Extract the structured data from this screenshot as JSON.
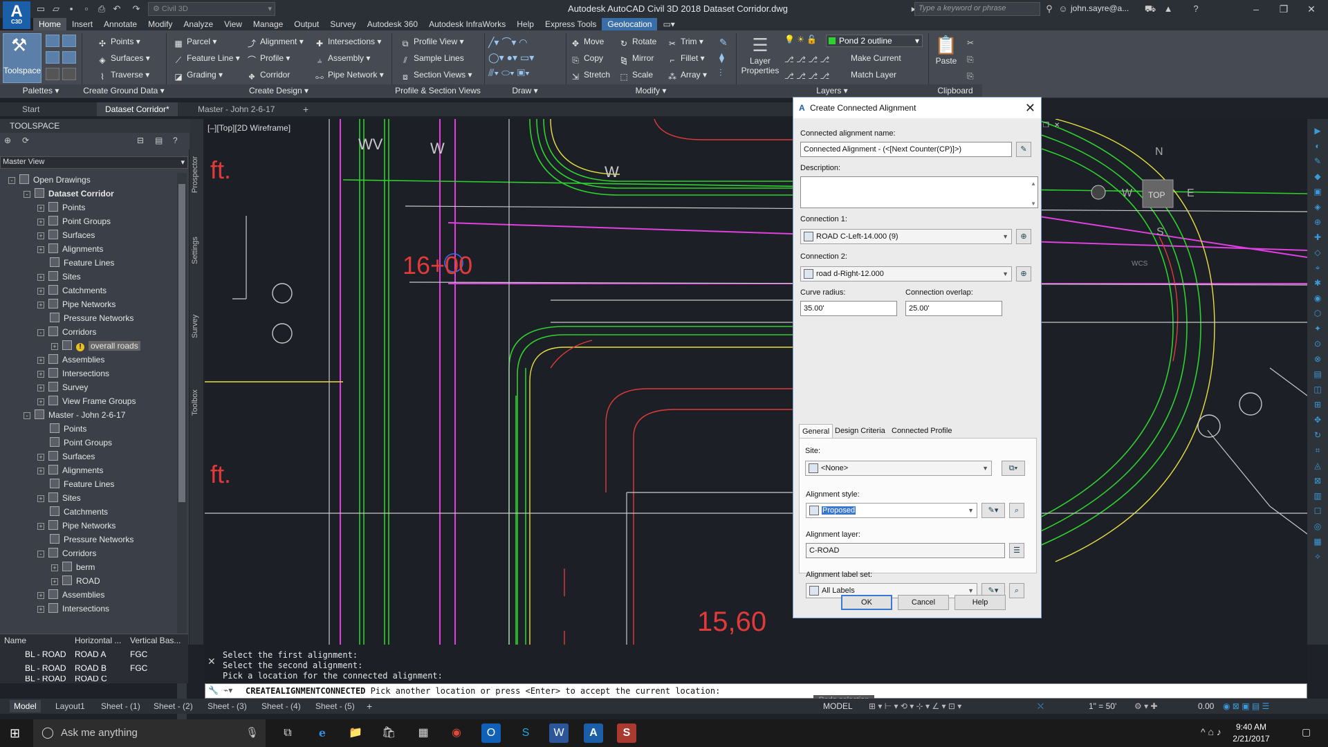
{
  "app": {
    "title": "Autodesk AutoCAD Civil 3D 2018   Dataset Corridor.dwg",
    "logo": "A",
    "logo_sub": "C3D",
    "workspace": "Civil 3D",
    "search_placeholder": "Type a keyword or phrase",
    "user": "john.sayre@a..."
  },
  "ribbon_tabs": [
    "Home",
    "Insert",
    "Annotate",
    "Modify",
    "Analyze",
    "View",
    "Manage",
    "Output",
    "Survey",
    "Autodesk 360",
    "Autodesk InfraWorks",
    "Help",
    "Express Tools",
    "Geolocation"
  ],
  "ribbon": {
    "toolspace": "Toolspace",
    "ground": [
      "Points",
      "Surfaces",
      "Traverse"
    ],
    "design_col1": [
      "Parcel",
      "Feature Line",
      "Grading"
    ],
    "design_col2": [
      "Alignment",
      "Profile",
      "Corridor"
    ],
    "design_col3": [
      "Intersections",
      "Assembly",
      "Pipe Network"
    ],
    "profile_col": [
      "Profile View",
      "Sample Lines",
      "Section Views"
    ],
    "modify_col1": [
      "Move",
      "Copy",
      "Stretch"
    ],
    "modify_col2": [
      "Rotate",
      "Mirror",
      "Scale"
    ],
    "modify_col3": [
      "Trim",
      "Fillet",
      "Array"
    ],
    "layer_props": "Layer Properties",
    "layer_current": "Pond 2 outline",
    "layer_make_current": "Make Current",
    "layer_match": "Match Layer",
    "paste": "Paste",
    "panels": [
      "Palettes",
      "Create Ground Data",
      "Create Design",
      "Profile & Section Views",
      "Draw",
      "Modify",
      "Layers",
      "Clipboard"
    ]
  },
  "doc_tabs": [
    "Start",
    "Dataset Corridor*",
    "Master - John 2-6-17"
  ],
  "toolspace": {
    "header": "TOOLSPACE",
    "view": "Master View",
    "side_tabs": [
      "Prospector",
      "Settings",
      "Survey",
      "Toolbox"
    ],
    "tree": [
      {
        "label": "Open Drawings",
        "lvl": 0,
        "exp": "-"
      },
      {
        "label": "Dataset Corridor",
        "lvl": 1,
        "exp": "-",
        "bold": true
      },
      {
        "label": "Points",
        "lvl": 2,
        "exp": "+"
      },
      {
        "label": "Point Groups",
        "lvl": 2,
        "exp": "+"
      },
      {
        "label": "Surfaces",
        "lvl": 2,
        "exp": "+"
      },
      {
        "label": "Alignments",
        "lvl": 2,
        "exp": "+"
      },
      {
        "label": "Feature Lines",
        "lvl": 2,
        "exp": ""
      },
      {
        "label": "Sites",
        "lvl": 2,
        "exp": "+"
      },
      {
        "label": "Catchments",
        "lvl": 2,
        "exp": "+"
      },
      {
        "label": "Pipe Networks",
        "lvl": 2,
        "exp": "+"
      },
      {
        "label": "Pressure Networks",
        "lvl": 2,
        "exp": ""
      },
      {
        "label": "Corridors",
        "lvl": 2,
        "exp": "-"
      },
      {
        "label": "overall roads",
        "lvl": 3,
        "exp": "+",
        "sel": true,
        "warn": true
      },
      {
        "label": "Assemblies",
        "lvl": 2,
        "exp": "+"
      },
      {
        "label": "Intersections",
        "lvl": 2,
        "exp": "+"
      },
      {
        "label": "Survey",
        "lvl": 2,
        "exp": "+"
      },
      {
        "label": "View Frame Groups",
        "lvl": 2,
        "exp": "+"
      },
      {
        "label": "Master - John 2-6-17",
        "lvl": 1,
        "exp": "-"
      },
      {
        "label": "Points",
        "lvl": 2,
        "exp": ""
      },
      {
        "label": "Point Groups",
        "lvl": 2,
        "exp": ""
      },
      {
        "label": "Surfaces",
        "lvl": 2,
        "exp": "+"
      },
      {
        "label": "Alignments",
        "lvl": 2,
        "exp": "+"
      },
      {
        "label": "Feature Lines",
        "lvl": 2,
        "exp": ""
      },
      {
        "label": "Sites",
        "lvl": 2,
        "exp": "+"
      },
      {
        "label": "Catchments",
        "lvl": 2,
        "exp": ""
      },
      {
        "label": "Pipe Networks",
        "lvl": 2,
        "exp": "+"
      },
      {
        "label": "Pressure Networks",
        "lvl": 2,
        "exp": ""
      },
      {
        "label": "Corridors",
        "lvl": 2,
        "exp": "-"
      },
      {
        "label": "berm",
        "lvl": 3,
        "exp": "+"
      },
      {
        "label": "ROAD",
        "lvl": 3,
        "exp": "+"
      },
      {
        "label": "Assemblies",
        "lvl": 2,
        "exp": "+"
      },
      {
        "label": "Intersections",
        "lvl": 2,
        "exp": "+"
      }
    ],
    "grid_headers": [
      "Name",
      "Horizontal ...",
      "Vertical Bas..."
    ],
    "grid_rows": [
      [
        "BL - ROAD",
        "ROAD A",
        "FGC"
      ],
      [
        "BL - ROAD",
        "ROAD B",
        "FGC"
      ],
      [
        "BL - ROAD",
        "ROAD C",
        ""
      ]
    ]
  },
  "viewport": {
    "label": "[–][Top][2D Wireframe]",
    "station": "16+00",
    "area_text": "15,60",
    "ft_text": "ft.",
    "compass": {
      "n": "N",
      "s": "S",
      "e": "E",
      "w": "W",
      "top": "TOP",
      "wcs": "WCS"
    }
  },
  "dialog": {
    "title": "Create Connected Alignment",
    "name_label": "Connected alignment name:",
    "name_value": "Connected Alignment - (<[Next Counter(CP)]>)",
    "desc_label": "Description:",
    "conn1_label": "Connection 1:",
    "conn1_value": "ROAD C-Left-14.000 (9)",
    "conn2_label": "Connection 2:",
    "conn2_value": "road d-Right-12.000",
    "radius_label": "Curve radius:",
    "radius_value": "35.00'",
    "overlap_label": "Connection overlap:",
    "overlap_value": "25.00'",
    "tabs": [
      "General",
      "Design Criteria",
      "Connected Profile"
    ],
    "site_label": "Site:",
    "site_value": "<None>",
    "style_label": "Alignment style:",
    "style_value": "Proposed",
    "layer_label": "Alignment layer:",
    "layer_value": "C-ROAD",
    "labelset_label": "Alignment label set:",
    "labelset_value": "All Labels",
    "ok": "OK",
    "cancel": "Cancel",
    "help": "Help"
  },
  "command": {
    "history": [
      "Select the first alignment:",
      "Select the second alignment:",
      "Pick a location for the connected alignment:"
    ],
    "current_cmd": "CREATEALIGNMENTCONNECTED",
    "current_prompt": "Pick another location or press <Enter> to accept the current location:",
    "tooltip": "Redo selection"
  },
  "status": {
    "layouts": [
      "Model",
      "Layout1",
      "Sheet - (1)",
      "Sheet - (2)",
      "Sheet - (3)",
      "Sheet - (4)",
      "Sheet - (5)"
    ],
    "model_btn": "MODEL",
    "scale": "1\" = 50'",
    "value": "0.00"
  },
  "taskbar": {
    "search": "Ask me anything",
    "time": "9:40 AM",
    "date": "2/21/2017"
  },
  "colors": {
    "accent": "#3b78d0",
    "magenta": "#e040e0",
    "green": "#2fd02f",
    "red": "#e03a3a",
    "yellow": "#e8e040"
  }
}
